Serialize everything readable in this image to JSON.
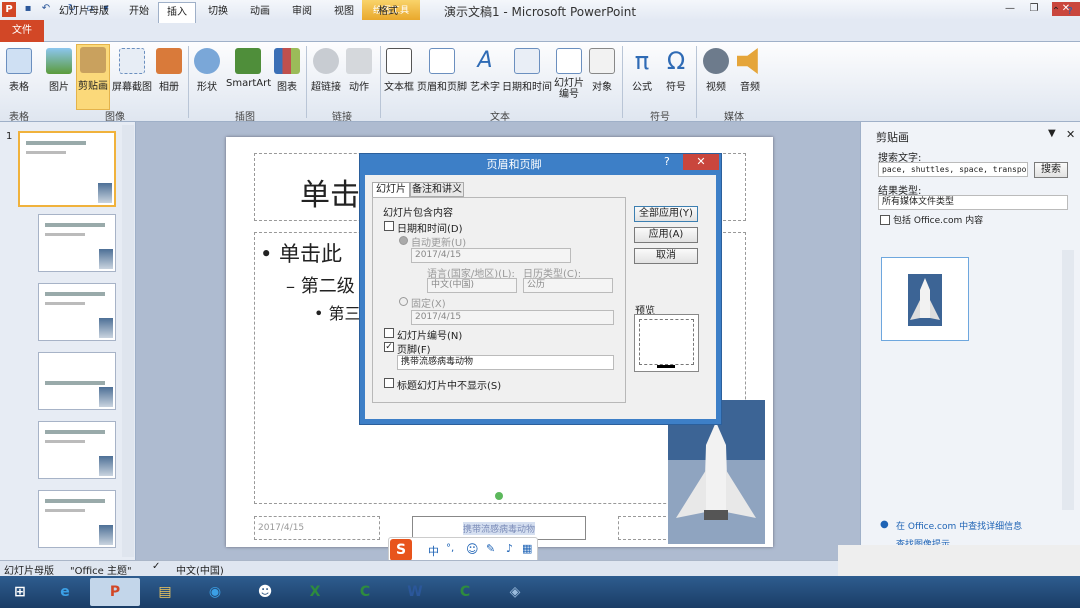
{
  "window": {
    "title": "演示文稿1 - Microsoft PowerPoint",
    "context_tab": "绘图工具",
    "app_icon": "P"
  },
  "tabs": [
    "文件",
    "幻灯片母版",
    "开始",
    "插入",
    "切换",
    "动画",
    "审阅",
    "视图",
    "格式"
  ],
  "ribbon": {
    "buttons": [
      "表格",
      "图片",
      "剪贴画",
      "屏幕截图",
      "相册",
      "形状",
      "SmartArt",
      "图表",
      "超链接",
      "动作",
      "文本框",
      "页眉和页脚",
      "艺术字",
      "日期和时间",
      "幻灯片\n编号",
      "对象",
      "公式",
      "符号",
      "视频",
      "音频"
    ],
    "groups": [
      "表格",
      "图像",
      "插图",
      "链接",
      "文本",
      "符号",
      "媒体"
    ]
  },
  "slide": {
    "title": "单击",
    "bullet1": "• 单击此",
    "bullet2": "– 第二级",
    "bullet3": "• 第三",
    "date_footer": "2017/4/15",
    "footer_text": "携带流感病毒动物"
  },
  "dialog": {
    "title": "页眉和页脚",
    "help": "?",
    "tab_slide": "幻灯片",
    "tab_notes": "备注和讲义",
    "section": "幻灯片包含内容",
    "datetime_label": "日期和时间(D)",
    "auto_update": "自动更新(U)",
    "auto_date": "2017/4/15",
    "language_label": "语言(国家/地区)(L):",
    "calendar_label": "日历类型(C):",
    "language_value": "中文(中国)",
    "calendar_value": "公历",
    "fixed_label": "固定(X)",
    "fixed_date": "2017/4/15",
    "slide_number": "幻灯片编号(N)",
    "footer_label": "页脚(F)",
    "footer_value": "携带流感病毒动物",
    "hide_title": "标题幻灯片中不显示(S)",
    "apply_all": "全部应用(Y)",
    "apply": "应用(A)",
    "cancel": "取消",
    "preview": "预览",
    "footer_checked": true,
    "datetime_checked": false
  },
  "clipart": {
    "title": "剪贴画",
    "search_label": "搜索文字:",
    "search_value": "pace, shuttles, space, transports",
    "search_btn": "搜索",
    "result_type_label": "结果类型:",
    "result_type_value": "所有媒体文件类型",
    "include_office": "包括 Office.com 内容",
    "link1": "在 Office.com 中查找详细信息",
    "link2": "查找图像提示"
  },
  "status": {
    "view": "幻灯片母版",
    "theme": "\"Office 主题\"",
    "lang": "中文(中国)"
  },
  "ime": {
    "label": "中"
  },
  "thumb_number": "1"
}
